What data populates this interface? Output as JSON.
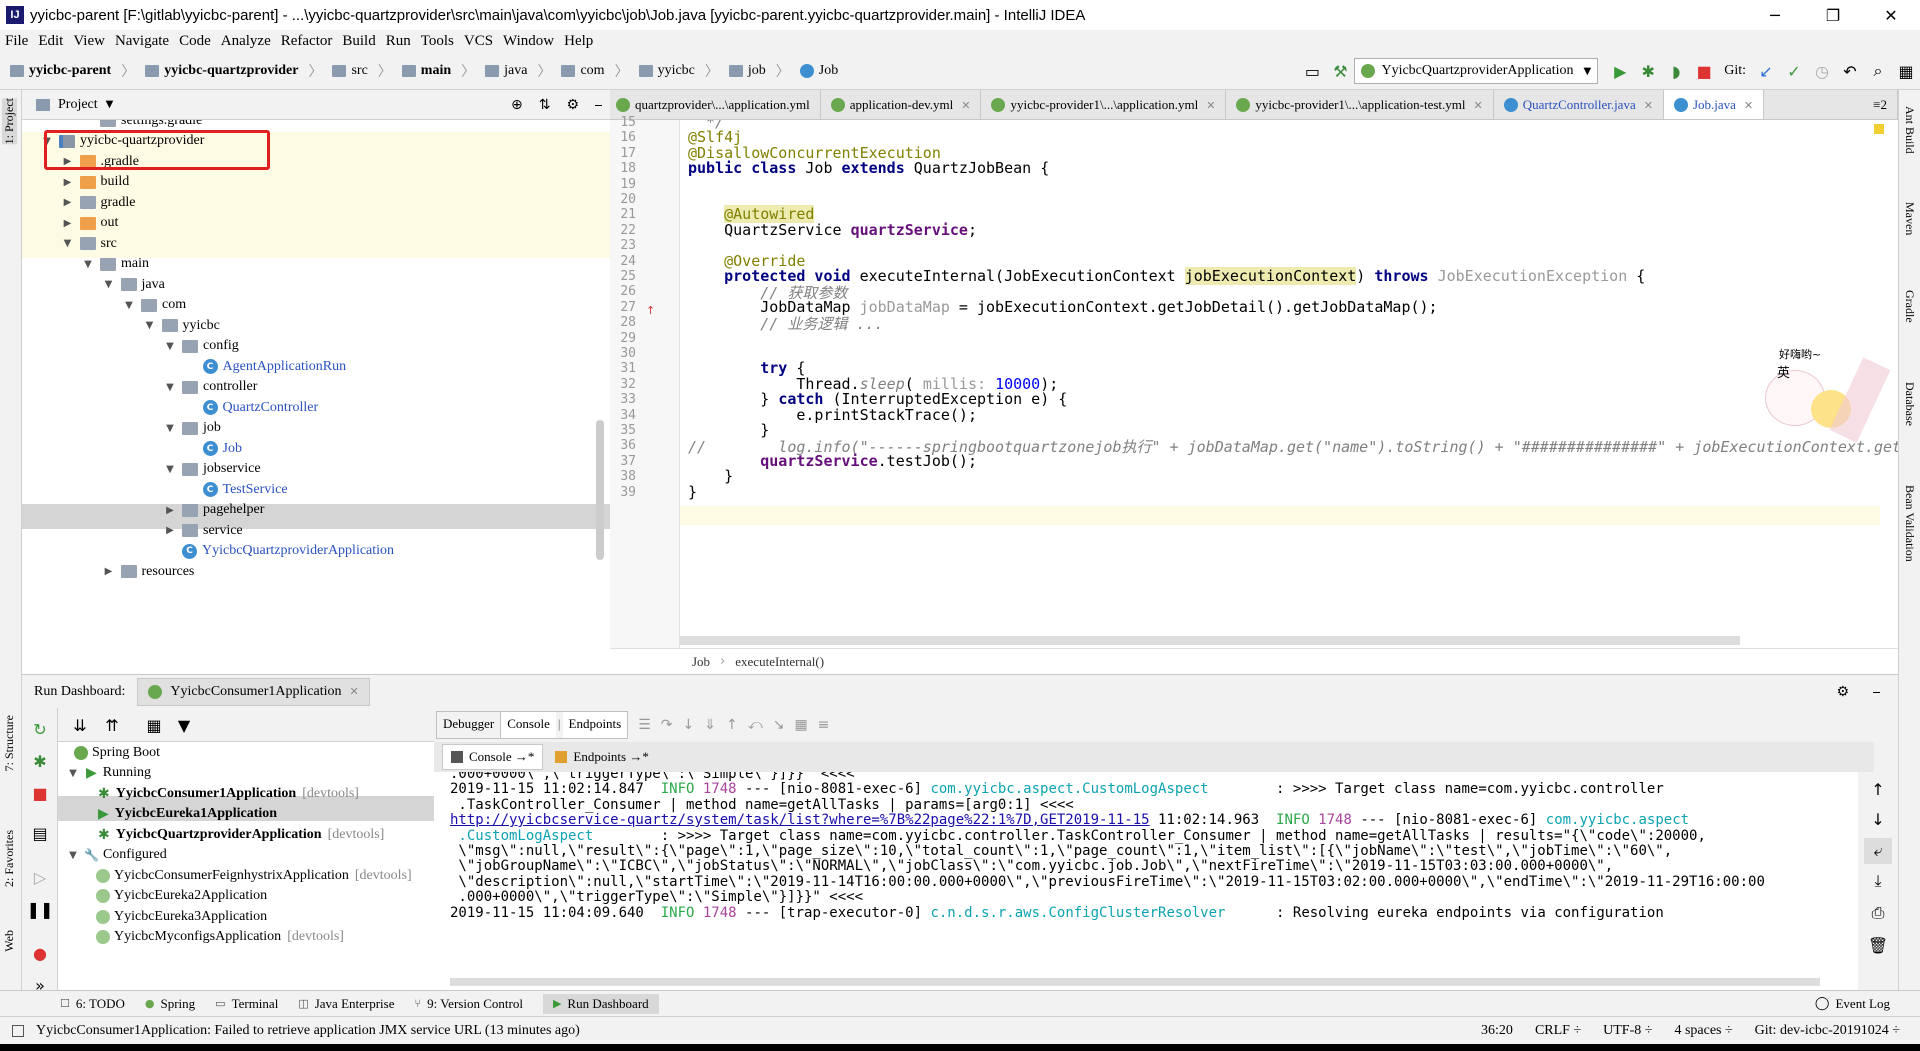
{
  "window": {
    "title": "yyicbc-parent [F:\\gitlab\\yyicbc-parent] - ...\\yyicbc-quartzprovider\\src\\main\\java\\com\\yyicbc\\job\\Job.java [yyicbc-parent.yyicbc-quartzprovider.main] - IntelliJ IDEA"
  },
  "menu": [
    "File",
    "Edit",
    "View",
    "Navigate",
    "Code",
    "Analyze",
    "Refactor",
    "Build",
    "Run",
    "Tools",
    "VCS",
    "Window",
    "Help"
  ],
  "breadcrumbs": [
    "yyicbc-parent",
    "yyicbc-quartzprovider",
    "src",
    "main",
    "java",
    "com",
    "yyicbc",
    "job",
    "Job"
  ],
  "run_config": "YyicbcQuartzproviderApplication",
  "git_label": "Git:",
  "project": {
    "title": "Project",
    "tree": [
      {
        "label": "settings.gradle",
        "indent": 2,
        "arrow": "",
        "icon": "file"
      },
      {
        "label": "yyicbc-quartzprovider",
        "indent": 0,
        "arrow": "down",
        "icon": "module"
      },
      {
        "label": ".gradle",
        "indent": 1,
        "arrow": "right",
        "icon": "orange"
      },
      {
        "label": "build",
        "indent": 1,
        "arrow": "right",
        "icon": "orange"
      },
      {
        "label": "gradle",
        "indent": 1,
        "arrow": "right",
        "icon": "folder"
      },
      {
        "label": "out",
        "indent": 1,
        "arrow": "right",
        "icon": "orange"
      },
      {
        "label": "src",
        "indent": 1,
        "arrow": "down",
        "icon": "folder"
      },
      {
        "label": "main",
        "indent": 2,
        "arrow": "down",
        "icon": "folder"
      },
      {
        "label": "java",
        "indent": 3,
        "arrow": "down",
        "icon": "folder"
      },
      {
        "label": "com",
        "indent": 4,
        "arrow": "down",
        "icon": "folder"
      },
      {
        "label": "yyicbc",
        "indent": 5,
        "arrow": "down",
        "icon": "folder"
      },
      {
        "label": "config",
        "indent": 6,
        "arrow": "down",
        "icon": "folder"
      },
      {
        "label": "AgentApplicationRun",
        "indent": 7,
        "arrow": "",
        "icon": "class"
      },
      {
        "label": "controller",
        "indent": 6,
        "arrow": "down",
        "icon": "folder"
      },
      {
        "label": "QuartzController",
        "indent": 7,
        "arrow": "",
        "icon": "class"
      },
      {
        "label": "job",
        "indent": 6,
        "arrow": "down",
        "icon": "folder"
      },
      {
        "label": "Job",
        "indent": 7,
        "arrow": "",
        "icon": "class"
      },
      {
        "label": "jobservice",
        "indent": 6,
        "arrow": "down",
        "icon": "folder"
      },
      {
        "label": "TestService",
        "indent": 7,
        "arrow": "",
        "icon": "class"
      },
      {
        "label": "pagehelper",
        "indent": 6,
        "arrow": "right",
        "icon": "folder"
      },
      {
        "label": "service",
        "indent": 6,
        "arrow": "right",
        "icon": "folder"
      },
      {
        "label": "YyicbcQuartzproviderApplication",
        "indent": 6,
        "arrow": "",
        "icon": "class"
      },
      {
        "label": "resources",
        "indent": 3,
        "arrow": "right",
        "icon": "folder"
      }
    ]
  },
  "tabs": [
    {
      "label": "quartzprovider\\...\\application.yml"
    },
    {
      "label": "application-dev.yml"
    },
    {
      "label": "yyicbc-provider1\\...\\application.yml"
    },
    {
      "label": "yyicbc-provider1\\...\\application-test.yml"
    },
    {
      "label": "QuartzController.java"
    },
    {
      "label": "Job.java"
    }
  ],
  "tabs_more": "≡2",
  "editor": {
    "line_numbers": [
      "15",
      "16",
      "17",
      "18",
      "19",
      "20",
      "21",
      "22",
      "23",
      "24",
      "25",
      "26",
      "27",
      "28",
      "29",
      "30",
      "31",
      "32",
      "33",
      "34",
      "35",
      "36",
      "37",
      "38",
      "39"
    ],
    "breadcrumb": [
      "Job",
      "executeInternal()"
    ],
    "lines": [
      {
        "parts": [
          {
            "t": "  */",
            "c": "cm"
          }
        ]
      },
      {
        "parts": [
          {
            "t": "@Slf4j",
            "c": "an"
          }
        ]
      },
      {
        "parts": [
          {
            "t": "@DisallowConcurrentExecution",
            "c": "an"
          }
        ]
      },
      {
        "parts": [
          {
            "t": "public class ",
            "c": "kw"
          },
          {
            "t": "Job ",
            "c": ""
          },
          {
            "t": "extends ",
            "c": "kw"
          },
          {
            "t": "QuartzJobBean {",
            "c": ""
          }
        ]
      },
      {
        "parts": []
      },
      {
        "parts": []
      },
      {
        "parts": [
          {
            "t": "    ",
            "c": ""
          },
          {
            "t": "@Autowired",
            "c": "an hl"
          }
        ]
      },
      {
        "parts": [
          {
            "t": "    QuartzService ",
            "c": ""
          },
          {
            "t": "quartzService",
            "c": "fd"
          },
          {
            "t": ";",
            "c": ""
          }
        ]
      },
      {
        "parts": []
      },
      {
        "parts": [
          {
            "t": "    ",
            "c": ""
          },
          {
            "t": "@Override",
            "c": "an"
          }
        ]
      },
      {
        "parts": [
          {
            "t": "    ",
            "c": ""
          },
          {
            "t": "protected void ",
            "c": "kw"
          },
          {
            "t": "executeInternal(JobExecutionContext ",
            "c": ""
          },
          {
            "t": "jobExecutionContext",
            "c": "hl"
          },
          {
            "t": ") ",
            "c": ""
          },
          {
            "t": "throws ",
            "c": "kw"
          },
          {
            "t": "JobExecutionException",
            "c": "dim"
          },
          {
            "t": " {",
            "c": ""
          }
        ]
      },
      {
        "parts": [
          {
            "t": "        // 获取参数",
            "c": "cm"
          }
        ]
      },
      {
        "parts": [
          {
            "t": "        JobDataMap ",
            "c": ""
          },
          {
            "t": "jobDataMap",
            "c": "dim"
          },
          {
            "t": " = jobExecutionContext.getJobDetail().getJobDataMap();",
            "c": ""
          }
        ]
      },
      {
        "parts": [
          {
            "t": "        // 业务逻辑 ...",
            "c": "cm"
          }
        ]
      },
      {
        "parts": []
      },
      {
        "parts": []
      },
      {
        "parts": [
          {
            "t": "        ",
            "c": ""
          },
          {
            "t": "try",
            "c": "kw"
          },
          {
            "t": " {",
            "c": ""
          }
        ]
      },
      {
        "parts": [
          {
            "t": "            Thread.",
            "c": ""
          },
          {
            "t": "sleep",
            "c": "cm"
          },
          {
            "t": "( ",
            "c": ""
          },
          {
            "t": "millis: ",
            "c": "dim"
          },
          {
            "t": "10000",
            "c": "num"
          },
          {
            "t": ");",
            "c": ""
          }
        ]
      },
      {
        "parts": [
          {
            "t": "        } ",
            "c": ""
          },
          {
            "t": "catch",
            "c": "kw"
          },
          {
            "t": " (InterruptedException e) {",
            "c": ""
          }
        ]
      },
      {
        "parts": [
          {
            "t": "            e.printStackTrace();",
            "c": ""
          }
        ]
      },
      {
        "parts": [
          {
            "t": "        }",
            "c": ""
          }
        ]
      },
      {
        "parts": [
          {
            "t": "//        log.info(\"------springbootquartzonejob执行\" + jobDataMap.get(\"name\").toString() + \"###############\" + jobExecutionContext.getJobDetail().getKey());",
            "c": "cm"
          }
        ]
      },
      {
        "parts": [
          {
            "t": "        ",
            "c": ""
          },
          {
            "t": "quartzService",
            "c": "fd"
          },
          {
            "t": ".testJob();",
            "c": ""
          }
        ]
      },
      {
        "parts": [
          {
            "t": "    }",
            "c": ""
          }
        ]
      },
      {
        "parts": [
          {
            "t": "}",
            "c": ""
          }
        ]
      }
    ]
  },
  "run_dashboard": {
    "title": "Run Dashboard:",
    "tab": "YyicbcConsumer1Application",
    "tree": [
      {
        "label": "Spring Boot",
        "tag": "",
        "indent": 0,
        "bold": false,
        "arrow": ""
      },
      {
        "label": "Running",
        "tag": "",
        "indent": 1,
        "bold": false,
        "arrow": "down"
      },
      {
        "label": "YyicbcConsumer1Application",
        "tag": "[devtools]",
        "indent": 2,
        "bold": true,
        "arrow": ""
      },
      {
        "label": "YyicbcEureka1Application",
        "tag": "",
        "indent": 2,
        "bold": true,
        "arrow": ""
      },
      {
        "label": "YyicbcQuartzproviderApplication",
        "tag": "[devtools]",
        "indent": 2,
        "bold": true,
        "arrow": ""
      },
      {
        "label": "Configured",
        "tag": "",
        "indent": 1,
        "bold": false,
        "arrow": "down"
      },
      {
        "label": "YyicbcConsumerFeignhystrixApplication",
        "tag": "[devtools]",
        "indent": 2,
        "bold": false,
        "arrow": ""
      },
      {
        "label": "YyicbcEureka2Application",
        "tag": "",
        "indent": 2,
        "bold": false,
        "arrow": ""
      },
      {
        "label": "YyicbcEureka3Application",
        "tag": "",
        "indent": 2,
        "bold": false,
        "arrow": ""
      },
      {
        "label": "YyicbcMyconfigsApplication",
        "tag": "[devtools]",
        "indent": 2,
        "bold": false,
        "arrow": ""
      }
    ]
  },
  "console": {
    "tabs": [
      "Debugger",
      "Console",
      "Endpoints"
    ],
    "subtabs": [
      "Console →*",
      "Endpoints →*"
    ],
    "lines": [
      {
        "parts": [
          {
            "t": ".000+0000\\\",\\\"triggerType\\\":\\\"Simple\\\"}]}}\" <<<<",
            "c": ""
          }
        ]
      },
      {
        "parts": [
          {
            "t": "2019-11-15 11:02:14.847  ",
            "c": ""
          },
          {
            "t": "INFO",
            "c": "cg"
          },
          {
            "t": " 1748 ",
            "c": "cp"
          },
          {
            "t": "--- [nio-8081-exec-6] ",
            "c": ""
          },
          {
            "t": "com.yyicbc.aspect.CustomLogAspect",
            "c": "cc"
          },
          {
            "t": "        : >>>> Target class name=com.yyicbc.controller",
            "c": ""
          }
        ]
      },
      {
        "parts": [
          {
            "t": " .TaskController_Consumer | method name=getAllTasks | params=[arg0:1] <<<<",
            "c": ""
          }
        ]
      },
      {
        "parts": [
          {
            "t": "http://yyicbcservice-quartz/system/task/list?where=%7B%22page%22:1%7D,GET2019-11-15",
            "c": "clink"
          },
          {
            "t": " 11:02:14.963  ",
            "c": ""
          },
          {
            "t": "INFO",
            "c": "cg"
          },
          {
            "t": " 1748 ",
            "c": "cp"
          },
          {
            "t": "--- [nio-8081-exec-6] ",
            "c": ""
          },
          {
            "t": "com.yyicbc.aspect",
            "c": "cc"
          }
        ]
      },
      {
        "parts": [
          {
            "t": " .CustomLogAspect",
            "c": "cc"
          },
          {
            "t": "        : >>>> Target class name=com.yyicbc.controller.TaskController_Consumer | method name=getAllTasks | results=\"{\\\"code\\\":20000,",
            "c": ""
          }
        ]
      },
      {
        "parts": [
          {
            "t": " \\\"msg\\\":null,\\\"result\\\":{\\\"page\\\":1,\\\"page_size\\\":10,\\\"total_count\\\":1,\\\"page_count\\\":1,\\\"item_list\\\":[{\\\"jobName\\\":\\\"test\\\",\\\"jobTime\\\":\\\"60\\\",",
            "c": ""
          }
        ]
      },
      {
        "parts": [
          {
            "t": " \\\"jobGroupName\\\":\\\"ICBC\\\",\\\"jobStatus\\\":\\\"NORMAL\\\",\\\"jobClass\\\":\\\"com.yyicbc.job.Job\\\",\\\"nextFireTime\\\":\\\"2019-11-15T03:03:00.000+0000\\\",",
            "c": ""
          }
        ]
      },
      {
        "parts": [
          {
            "t": " \\\"description\\\":null,\\\"startTime\\\":\\\"2019-11-14T16:00:00.000+0000\\\",\\\"previousFireTime\\\":\\\"2019-11-15T03:02:00.000+0000\\\",\\\"endTime\\\":\\\"2019-11-29T16:00:00",
            "c": ""
          }
        ]
      },
      {
        "parts": [
          {
            "t": " .000+0000\\\",\\\"triggerType\\\":\\\"Simple\\\"}]}}\" <<<<",
            "c": ""
          }
        ]
      },
      {
        "parts": [
          {
            "t": "2019-11-15 11:04:09.640  ",
            "c": ""
          },
          {
            "t": "INFO",
            "c": "cg"
          },
          {
            "t": " 1748 ",
            "c": "cp"
          },
          {
            "t": "--- [trap-executor-0] ",
            "c": ""
          },
          {
            "t": "c.n.d.s.r.aws.ConfigClusterResolver",
            "c": "cc"
          },
          {
            "t": "      : Resolving eureka endpoints via configuration",
            "c": ""
          }
        ]
      }
    ]
  },
  "bottom_tabs": [
    "6: TODO",
    "Spring",
    "Terminal",
    "Java Enterprise",
    "9: Version Control",
    "Run Dashboard"
  ],
  "event_log": "Event Log",
  "status": {
    "message": "YyicbcConsumer1Application: Failed to retrieve application JMX service URL (13 minutes ago)",
    "position": "36:20",
    "line_sep": "CRLF ÷",
    "encoding": "UTF-8 ÷",
    "indent": "4 spaces ÷",
    "git": "Git: dev-icbc-20191024 ÷"
  },
  "left_strip": [
    "1: Project",
    "7: Structure",
    "2: Favorites",
    "Web"
  ],
  "right_strip": [
    "Ant Build",
    "Maven",
    "Gradle",
    "Database",
    "Bean Validation"
  ],
  "sticker": {
    "text": "好嗨哟~",
    "ime": "英"
  },
  "colors": {
    "highlight": "#edebb0",
    "keyword": "#000080",
    "annotation": "#808000",
    "field": "#660e7a",
    "selection_box": "#e02020"
  }
}
